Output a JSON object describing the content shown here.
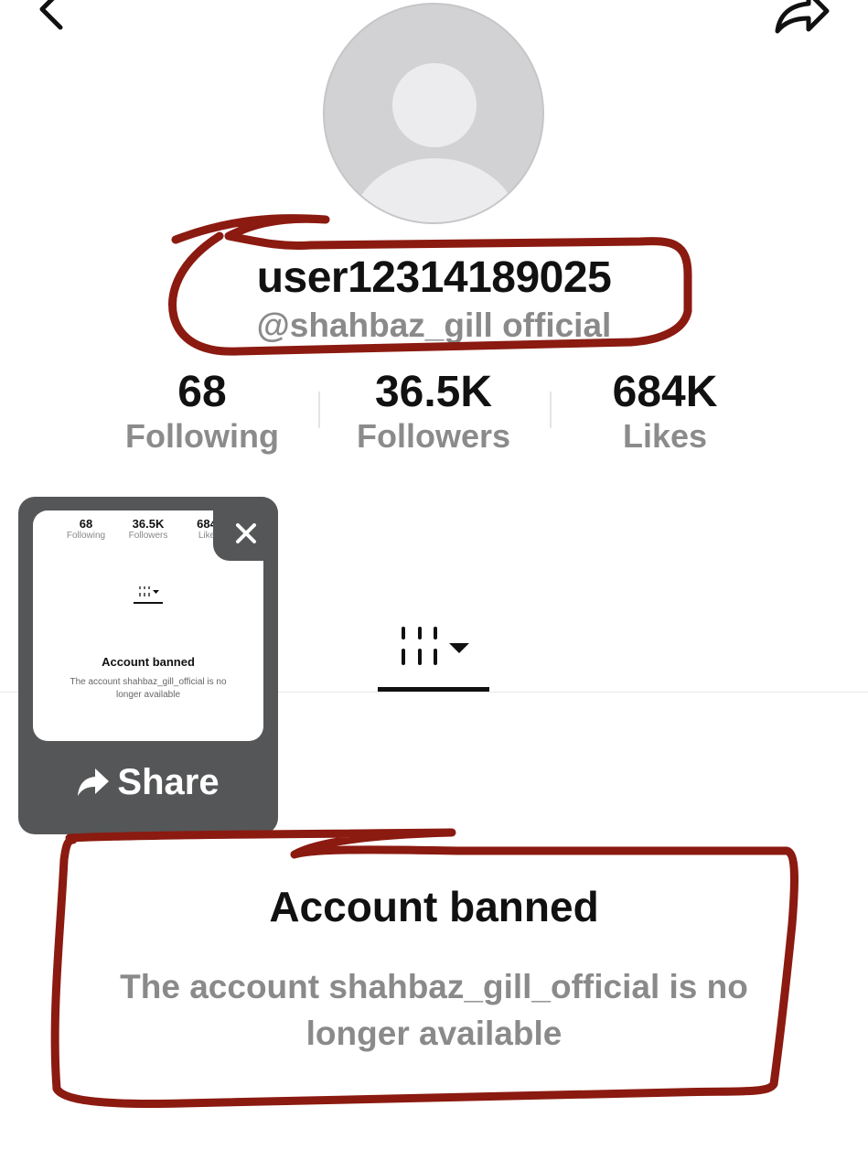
{
  "profile": {
    "display_name": "user12314189025",
    "handle": "@shahbaz_gill official"
  },
  "stats": [
    {
      "value": "68",
      "label": "Following"
    },
    {
      "value": "36.5K",
      "label": "Followers"
    },
    {
      "value": "684K",
      "label": "Likes"
    }
  ],
  "notice": {
    "title": "Account banned",
    "description": "The account shahbaz_gill_official is no longer available"
  },
  "preview_card": {
    "stats": [
      {
        "value": "68",
        "label": "Following"
      },
      {
        "value": "36.5K",
        "label": "Followers"
      },
      {
        "value": "684",
        "label": "Like"
      }
    ],
    "title": "Account banned",
    "description": "The account shahbaz_gill_official is no longer available",
    "share_label": "Share"
  },
  "icons": {
    "back": "chevron-left-icon",
    "share": "share-arrow-icon",
    "grid": "grid-icon",
    "close": "close-icon"
  },
  "colors": {
    "annotation": "#8b1a10",
    "muted_text": "#8a8a8a",
    "card_bg": "#555657"
  }
}
